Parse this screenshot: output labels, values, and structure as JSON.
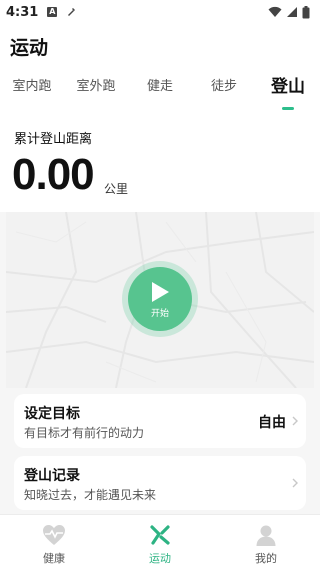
{
  "status_bar": {
    "time": "4:31",
    "left_icons": [
      "a-badge-icon",
      "pen-icon"
    ],
    "right_icons": [
      "wifi-icon",
      "signal-icon",
      "battery-icon"
    ]
  },
  "header": {
    "title": "运动"
  },
  "tabs": [
    {
      "label": "室内跑",
      "active": false
    },
    {
      "label": "室外跑",
      "active": false
    },
    {
      "label": "健走",
      "active": false
    },
    {
      "label": "徒步",
      "active": false
    },
    {
      "label": "登山",
      "active": true
    }
  ],
  "stats": {
    "label": "累计登山距离",
    "value": "0.00",
    "unit": "公里"
  },
  "map": {
    "start_label": "开始",
    "start_icon": "play-icon"
  },
  "goal_card": {
    "title": "设定目标",
    "subtitle": "有目标才有前行的动力",
    "value": "自由"
  },
  "record_card": {
    "title": "登山记录",
    "subtitle": "知晓过去，才能遇见未来"
  },
  "bottom_nav": [
    {
      "label": "健康",
      "icon": "heart-pulse-icon",
      "active": false
    },
    {
      "label": "运动",
      "icon": "running-icon",
      "active": true
    },
    {
      "label": "我的",
      "icon": "person-icon",
      "active": false
    }
  ],
  "colors": {
    "accent": "#2dbe8c",
    "start_button": "#57c48f",
    "background": "#f6f6f6"
  }
}
